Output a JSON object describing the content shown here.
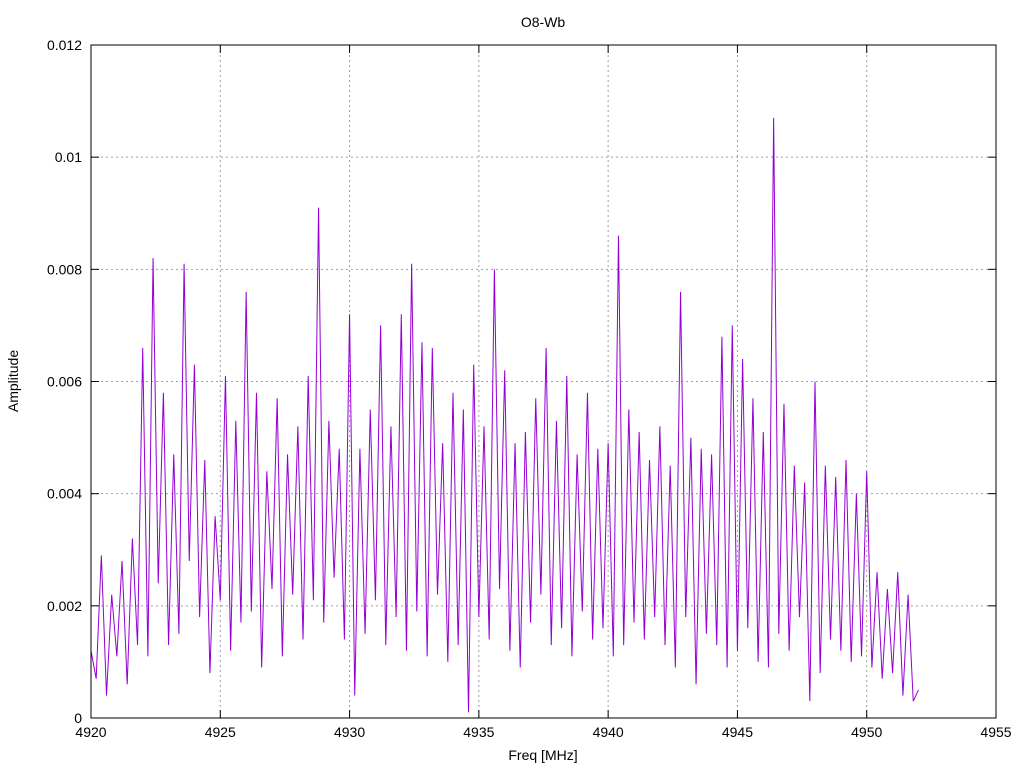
{
  "chart_data": {
    "type": "line",
    "title": "O8-Wb",
    "xlabel": "Freq [MHz]",
    "ylabel": "Amplitude",
    "xlim": [
      4920,
      4955
    ],
    "ylim": [
      0,
      0.012
    ],
    "xticks": [
      "4920",
      "4925",
      "4930",
      "4935",
      "4940",
      "4945",
      "4950",
      "4955"
    ],
    "yticks": [
      "0",
      "0.002",
      "0.004",
      "0.006",
      "0.008",
      "0.01",
      "0.012"
    ],
    "grid": true,
    "legend": "none",
    "series": [
      {
        "name": "O8-Wb",
        "color": "#9400d3",
        "x_start": 4920.0,
        "x_step": 0.2,
        "values": [
          0.0012,
          0.0007,
          0.0029,
          0.0004,
          0.0022,
          0.0011,
          0.0028,
          0.0006,
          0.0032,
          0.0013,
          0.0066,
          0.0011,
          0.0082,
          0.0024,
          0.0058,
          0.0013,
          0.0047,
          0.0015,
          0.0081,
          0.0028,
          0.0063,
          0.0018,
          0.0046,
          0.0008,
          0.0036,
          0.0021,
          0.0061,
          0.0012,
          0.0053,
          0.0017,
          0.0076,
          0.0019,
          0.0058,
          0.0009,
          0.0044,
          0.0023,
          0.0057,
          0.0011,
          0.0047,
          0.0022,
          0.0052,
          0.0014,
          0.0061,
          0.0021,
          0.0091,
          0.0017,
          0.0053,
          0.0025,
          0.0048,
          0.0014,
          0.0072,
          0.0004,
          0.0048,
          0.0015,
          0.0055,
          0.0021,
          0.007,
          0.0013,
          0.0052,
          0.0018,
          0.0072,
          0.0012,
          0.0081,
          0.0019,
          0.0067,
          0.0011,
          0.0066,
          0.0022,
          0.0049,
          0.001,
          0.0058,
          0.0013,
          0.0055,
          0.0001,
          0.0063,
          0.0018,
          0.0052,
          0.0014,
          0.008,
          0.0023,
          0.0062,
          0.0012,
          0.0049,
          0.0009,
          0.0051,
          0.0017,
          0.0057,
          0.0022,
          0.0066,
          0.0013,
          0.0053,
          0.0016,
          0.0061,
          0.0011,
          0.0047,
          0.0019,
          0.0058,
          0.0014,
          0.0048,
          0.0016,
          0.0049,
          0.0011,
          0.0086,
          0.0013,
          0.0055,
          0.0017,
          0.0051,
          0.0014,
          0.0046,
          0.0018,
          0.0052,
          0.0013,
          0.0045,
          0.0009,
          0.0076,
          0.0018,
          0.005,
          0.0006,
          0.0048,
          0.0015,
          0.0047,
          0.0013,
          0.0068,
          0.0009,
          0.007,
          0.0012,
          0.0064,
          0.0016,
          0.0057,
          0.001,
          0.0051,
          0.0009,
          0.0107,
          0.0015,
          0.0056,
          0.0012,
          0.0045,
          0.0018,
          0.0042,
          0.0003,
          0.006,
          0.0008,
          0.0045,
          0.0014,
          0.0043,
          0.0012,
          0.0046,
          0.001,
          0.004,
          0.0011,
          0.0044,
          0.0009,
          0.0026,
          0.0007,
          0.0023,
          0.0008,
          0.0026,
          0.0004,
          0.0022,
          0.0003,
          0.0005
        ]
      }
    ]
  }
}
